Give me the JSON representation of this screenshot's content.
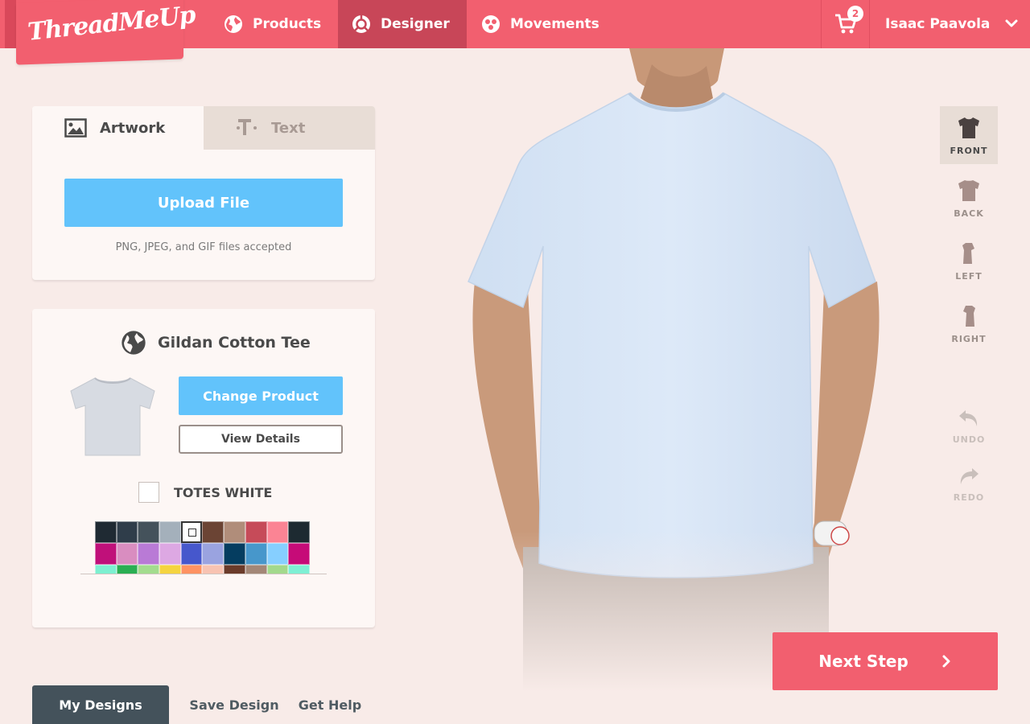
{
  "brand": {
    "logo_text": "ThreadMeUp"
  },
  "nav": {
    "products": "Products",
    "designer": "Designer",
    "movements": "Movements",
    "cart_count": "2",
    "user_name": "Isaac Paavola"
  },
  "artwork_panel": {
    "tab_artwork": "Artwork",
    "tab_text": "Text",
    "upload_label": "Upload File",
    "upload_note": "PNG, JPEG, and GIF files accepted"
  },
  "product_panel": {
    "title": "Gildan Cotton Tee",
    "change_label": "Change Product",
    "details_label": "View Details",
    "color_name": "TOTES WHITE",
    "swatches": [
      "#1f2a33",
      "#2f3d4a",
      "#44525b",
      "#a4b0bb",
      "#ffffff",
      "#6b4434",
      "#b08d7a",
      "#c64b59",
      "#fb8494",
      "#1d2a31",
      "#c0107a",
      "#d98dc0",
      "#b97ad6",
      "#dda8e3",
      "#4657cc",
      "#9aa3e0",
      "#053d60",
      "#4797cb",
      "#86cfff",
      "#c60b78",
      "#7df0d0",
      "#2aae52",
      "#a3dc8e",
      "#f5d440",
      "#ff9262",
      "#f8c3b2",
      "#6b3b2a",
      "#a38777",
      "#a3d98c",
      "#7ef0d4"
    ],
    "selected_swatch_index": 4
  },
  "views": {
    "front": "FRONT",
    "back": "BACK",
    "left": "LEFT",
    "right": "RIGHT",
    "undo": "UNDO",
    "redo": "REDO",
    "active": "front"
  },
  "actions": {
    "next_step": "Next Step"
  },
  "bottom_tabs": {
    "my_designs": "My Designs",
    "save_design": "Save Design",
    "get_help": "Get Help"
  },
  "colors": {
    "brand": "#f25f6f",
    "brand_dark": "#c84658",
    "accent_blue": "#62c3fb",
    "background": "#f8ebe8",
    "shirt": "#d9e8f8"
  }
}
